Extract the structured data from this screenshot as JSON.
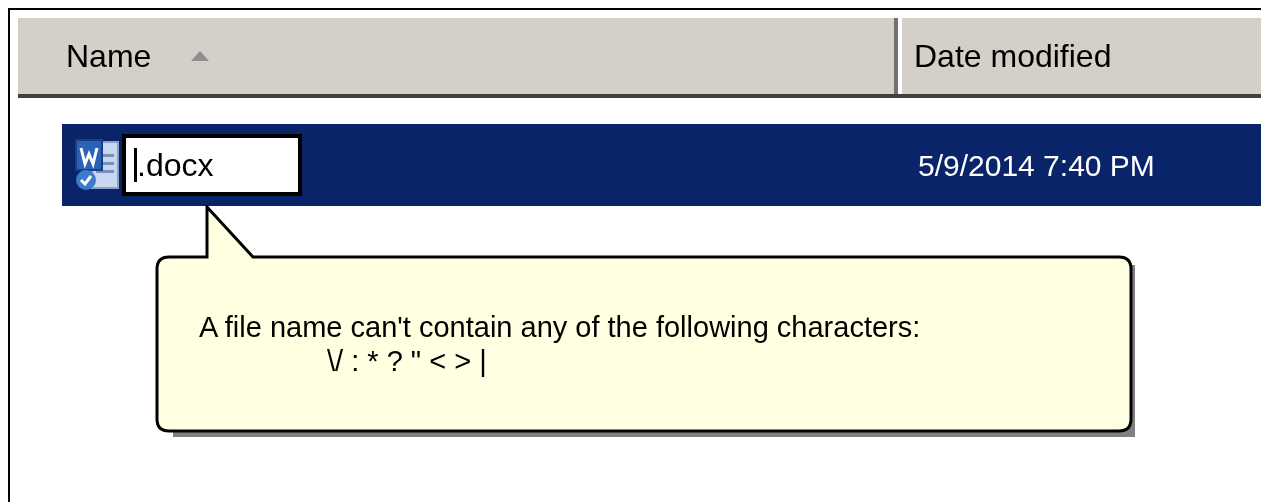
{
  "columns": [
    {
      "label": "Name",
      "sorted": true
    },
    {
      "label": "Date modified",
      "sorted": false
    }
  ],
  "rows": [
    {
      "name": ".docx",
      "date": "5/9/2014 7:40 PM",
      "selected": true,
      "editing": true
    }
  ],
  "tooltip": {
    "lines": [
      "A file name can't contain any of the following characters:",
      "\\/ : * ? \" < > |"
    ]
  }
}
